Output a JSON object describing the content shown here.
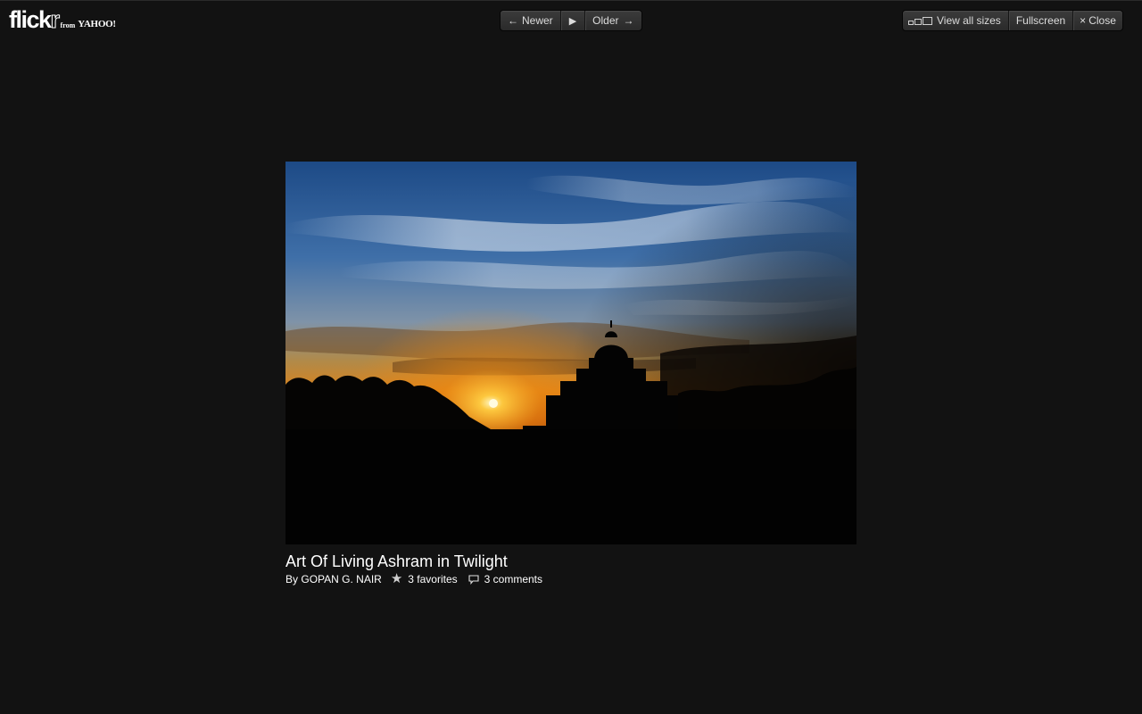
{
  "logo": {
    "brand": "flick",
    "brand_r": "r",
    "from": "from",
    "yahoo": "YAHOO!"
  },
  "nav": {
    "newer_label": "Newer",
    "older_label": "Older",
    "newer_icon": "arrow-left-icon",
    "play_icon": "play-icon",
    "older_icon": "arrow-right-icon"
  },
  "actions": {
    "view_all_sizes_label": "View all sizes",
    "fullscreen_label": "Fullscreen",
    "close_label": "Close",
    "close_icon": "close-icon",
    "sizes_icon": "sizes-icon"
  },
  "photo": {
    "title": "Art Of Living Ashram in Twilight",
    "author_prefix": "By",
    "author": "GOPAN G. NAIR",
    "favorites": "3 favorites",
    "comments": "3 comments"
  },
  "colors": {
    "background": "#121212",
    "button_bg": "#2f2f2f",
    "text": "#ffffff"
  }
}
